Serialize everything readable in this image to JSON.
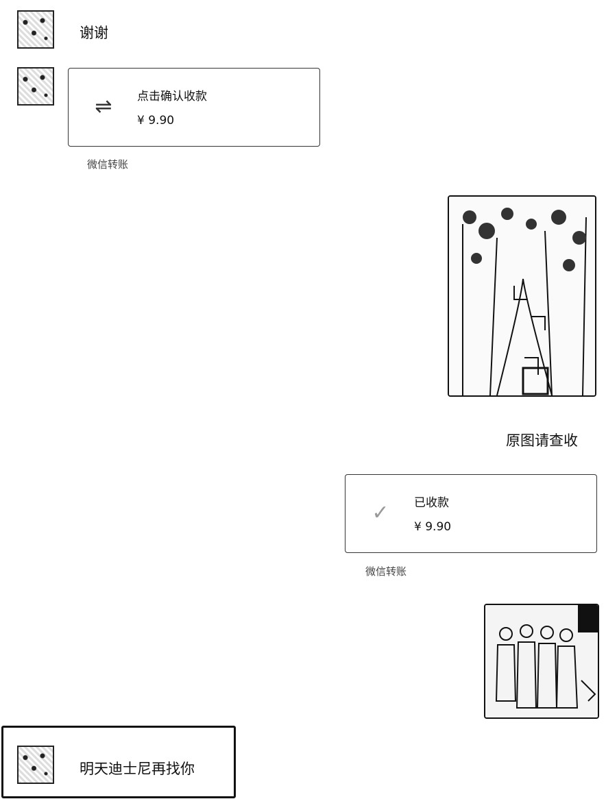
{
  "messages": {
    "m1_text": "谢谢",
    "m2_transfer": {
      "title": "点击确认收款",
      "amount": "¥ 9.90",
      "footer": "微信转账",
      "icon": "transfer-arrows-icon"
    },
    "m3_caption": "原图请查收",
    "m4_transfer": {
      "title": "已收款",
      "amount": "¥ 9.90",
      "footer": "微信转账",
      "icon": "check-icon"
    },
    "m5_text": "明天迪士尼再找你"
  }
}
